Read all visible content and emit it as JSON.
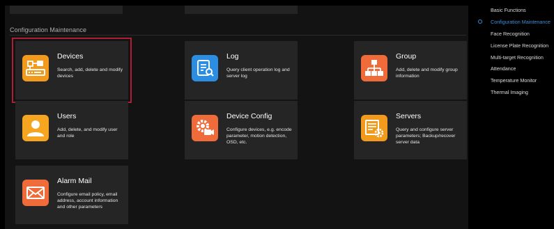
{
  "section": {
    "title": "Configuration Maintenance"
  },
  "cards": [
    {
      "title": "Devices",
      "desc": "Search, add, delete and modify devices",
      "icon": "devices-icon",
      "color": "#f29a1c",
      "selected": true
    },
    {
      "title": "Log",
      "desc": "Query client operation log and server log",
      "icon": "log-icon",
      "color": "#2b8ee3",
      "selected": false
    },
    {
      "title": "Group",
      "desc": "Add, delete and modify group information",
      "icon": "group-icon",
      "color": "#ef6b3a",
      "selected": false
    },
    {
      "title": "Users",
      "desc": "Add, delete, and modify user and role",
      "icon": "user-icon",
      "color": "#f5a51f",
      "selected": false
    },
    {
      "title": "Device Config",
      "desc": "Configure devices, e.g. encode parameter, motion detection, OSD, etc.",
      "icon": "device-config-icon",
      "color": "#ef6b3a",
      "selected": false
    },
    {
      "title": "Servers",
      "desc": "Query and configure server parameters; Backup/recover server data",
      "icon": "servers-icon",
      "color": "#f29a1c",
      "selected": false
    },
    {
      "title": "Alarm Mail",
      "desc": "Configure email policy, email address, account information and other parameters",
      "icon": "mail-icon",
      "color": "#ef6b3a",
      "selected": false
    }
  ],
  "sidebar": {
    "items": [
      {
        "label": "Basic Functions",
        "active": false
      },
      {
        "label": "Configuration Maintenance",
        "active": true
      },
      {
        "label": "Face Recognition",
        "active": false
      },
      {
        "label": "License Plate Recognition",
        "active": false
      },
      {
        "label": "Multi-target Recognition",
        "active": false
      },
      {
        "label": "Attendance",
        "active": false
      },
      {
        "label": "Temperature Monitor",
        "active": false
      },
      {
        "label": "Thermal Imaging",
        "active": false
      }
    ]
  },
  "colors": {
    "accent": "#3f8fd8",
    "selection": "#b01e35",
    "card_bg": "#252525"
  }
}
